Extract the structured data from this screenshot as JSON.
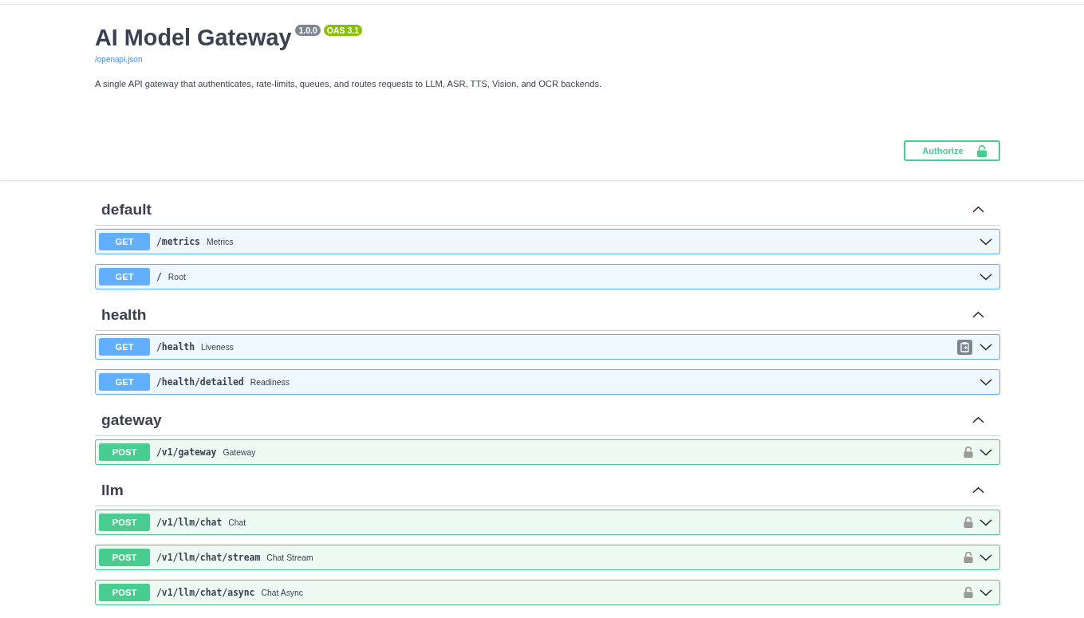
{
  "header": {
    "title": "AI Model Gateway",
    "badges": [
      {
        "label": "1.0.0",
        "color": "#7d8492"
      },
      {
        "label": "OAS 3.1",
        "color": "#89bf04"
      }
    ],
    "spec_link": "/openapi.json",
    "description": "A single API gateway that authenticates, rate-limits, queues, and routes requests to LLM, ASR, TTS, Vision, and OCR backends."
  },
  "authorize_button": {
    "label": "Authorize"
  },
  "sections": [
    {
      "name": "default",
      "expanded": true,
      "operations": [
        {
          "kind": "get",
          "method": "GET",
          "path": "/metrics",
          "summary": "Metrics",
          "secured": false,
          "hovered": false,
          "expanded": false
        },
        {
          "kind": "get",
          "method": "GET",
          "path": "/",
          "summary": "Root",
          "secured": false,
          "hovered": false,
          "expanded": false
        }
      ]
    },
    {
      "name": "health",
      "expanded": true,
      "operations": [
        {
          "kind": "get",
          "method": "GET",
          "path": "/health",
          "summary": "Liveness",
          "secured": false,
          "hovered": true,
          "expanded": false
        },
        {
          "kind": "get",
          "method": "GET",
          "path": "/health/detailed",
          "summary": "Readiness",
          "secured": false,
          "hovered": false,
          "expanded": false
        }
      ]
    },
    {
      "name": "gateway",
      "expanded": true,
      "operations": [
        {
          "kind": "post",
          "method": "POST",
          "path": "/v1/gateway",
          "summary": "Gateway",
          "secured": true,
          "hovered": false,
          "expanded": false
        }
      ]
    },
    {
      "name": "llm",
      "expanded": true,
      "operations": [
        {
          "kind": "post",
          "method": "POST",
          "path": "/v1/llm/chat",
          "summary": "Chat",
          "secured": true,
          "hovered": false,
          "expanded": false
        },
        {
          "kind": "post",
          "method": "POST",
          "path": "/v1/llm/chat/stream",
          "summary": "Chat Stream",
          "secured": true,
          "hovered": false,
          "expanded": false
        },
        {
          "kind": "post",
          "method": "POST",
          "path": "/v1/llm/chat/async",
          "summary": "Chat Async",
          "secured": true,
          "hovered": false,
          "expanded": false
        }
      ]
    }
  ]
}
